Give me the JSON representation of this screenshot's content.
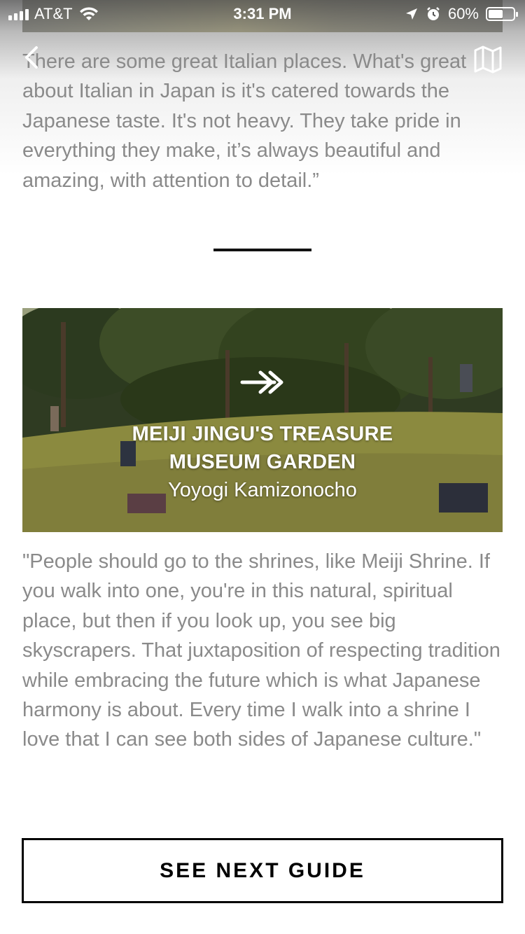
{
  "status_bar": {
    "carrier": "AT&T",
    "time": "3:31 PM",
    "battery": "60%",
    "battery_level": 0.6
  },
  "nav": {
    "back_icon": "chevron-left-icon",
    "map_icon": "map-icon"
  },
  "quote_top": "There are some great Italian places. What's great about Italian in Japan is it's catered towards the Japanese taste. It's not heavy. They take pride in everything they make, it’s always beautiful and amazing, with attention to detail.”",
  "place_card": {
    "name_line1": "MEIJI JINGU'S TREASURE",
    "name_line2": "MUSEUM GARDEN",
    "location": "Yoyogi Kamizonocho",
    "arrow_icon": "double-arrow-right-icon"
  },
  "quote_bottom": "\"People should go to the shrines, like Meiji Shrine. If you walk into one, you're in this natural, spiritual place, but then if you look up, you see big skyscrapers. That juxtaposition of respecting tradition while embracing the future which is what Japanese harmony is about. Every time I walk into a shrine I love that I can see both sides of Japanese culture.\"",
  "next_button": {
    "label": "SEE NEXT GUIDE"
  },
  "colors": {
    "body_text": "#8a8a8a",
    "button_border": "#000000",
    "background": "#ffffff"
  }
}
